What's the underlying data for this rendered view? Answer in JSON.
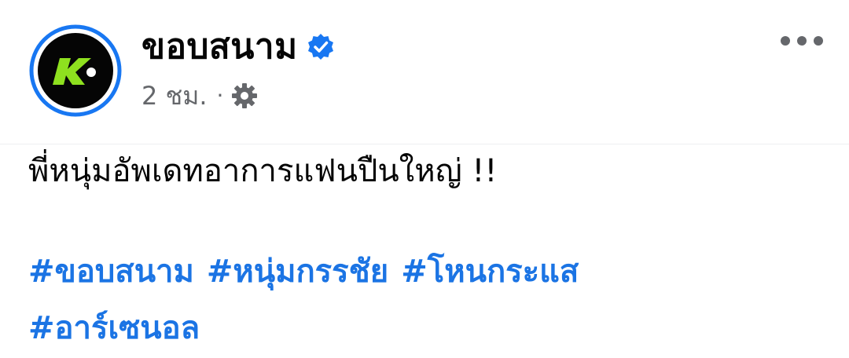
{
  "post": {
    "author": {
      "name": "ขอบสนาม",
      "verified": true,
      "avatar_icon": "k-logo-icon",
      "avatar_ring_color": "#1877f2",
      "avatar_bg_color": "#050505",
      "avatar_accent_color": "#8ee01f"
    },
    "meta": {
      "timestamp": "2 ชม.",
      "separator": "·",
      "privacy_icon": "gear-icon"
    },
    "more_menu_icon": "more-horizontal-icon",
    "text": "พี่หนุ่มอัพเดทอาการแฟนปืนใหญ่ !!",
    "hashtags": [
      "#ขอบสนาม",
      "#หนุ่มกรรชัย",
      "#โหนกระแส",
      "#อาร์เซนอล"
    ],
    "colors": {
      "link": "#1b74e4",
      "text": "#050505",
      "secondary": "#65676b",
      "verified_badge": "#1877f2"
    }
  }
}
